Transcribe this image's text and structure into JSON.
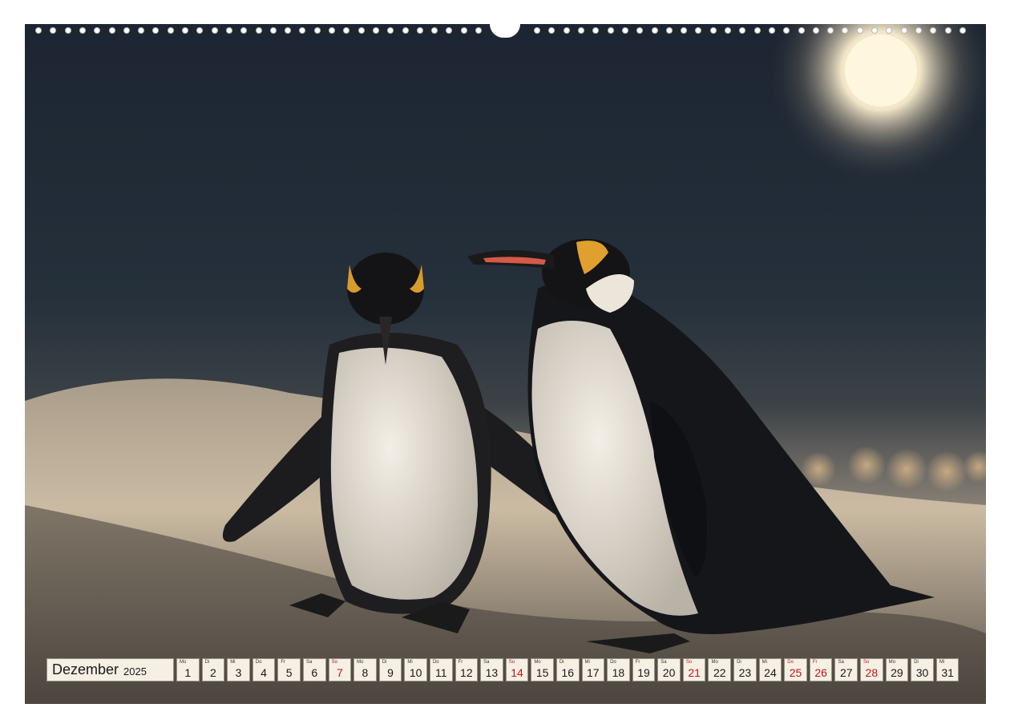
{
  "calendar": {
    "month": "Dezember",
    "year": "2025",
    "weekend_color": "#c0141c",
    "days": [
      {
        "wd": "Mo",
        "n": "1",
        "red": false
      },
      {
        "wd": "Di",
        "n": "2",
        "red": false
      },
      {
        "wd": "Mi",
        "n": "3",
        "red": false
      },
      {
        "wd": "Do",
        "n": "4",
        "red": false
      },
      {
        "wd": "Fr",
        "n": "5",
        "red": false
      },
      {
        "wd": "Sa",
        "n": "6",
        "red": false
      },
      {
        "wd": "So",
        "n": "7",
        "red": true
      },
      {
        "wd": "Mo",
        "n": "8",
        "red": false
      },
      {
        "wd": "Di",
        "n": "9",
        "red": false
      },
      {
        "wd": "Mi",
        "n": "10",
        "red": false
      },
      {
        "wd": "Do",
        "n": "11",
        "red": false
      },
      {
        "wd": "Fr",
        "n": "12",
        "red": false
      },
      {
        "wd": "Sa",
        "n": "13",
        "red": false
      },
      {
        "wd": "So",
        "n": "14",
        "red": true
      },
      {
        "wd": "Mo",
        "n": "15",
        "red": false
      },
      {
        "wd": "Di",
        "n": "16",
        "red": false
      },
      {
        "wd": "Mi",
        "n": "17",
        "red": false
      },
      {
        "wd": "Do",
        "n": "18",
        "red": false
      },
      {
        "wd": "Fr",
        "n": "19",
        "red": false
      },
      {
        "wd": "Sa",
        "n": "20",
        "red": false
      },
      {
        "wd": "So",
        "n": "21",
        "red": true
      },
      {
        "wd": "Mo",
        "n": "22",
        "red": false
      },
      {
        "wd": "Di",
        "n": "23",
        "red": false
      },
      {
        "wd": "Mi",
        "n": "24",
        "red": false
      },
      {
        "wd": "Do",
        "n": "25",
        "red": true
      },
      {
        "wd": "Fr",
        "n": "26",
        "red": true
      },
      {
        "wd": "Sa",
        "n": "27",
        "red": false
      },
      {
        "wd": "So",
        "n": "28",
        "red": true
      },
      {
        "wd": "Mo",
        "n": "29",
        "red": false
      },
      {
        "wd": "Di",
        "n": "30",
        "red": false
      },
      {
        "wd": "Mi",
        "n": "31",
        "red": false
      }
    ]
  }
}
